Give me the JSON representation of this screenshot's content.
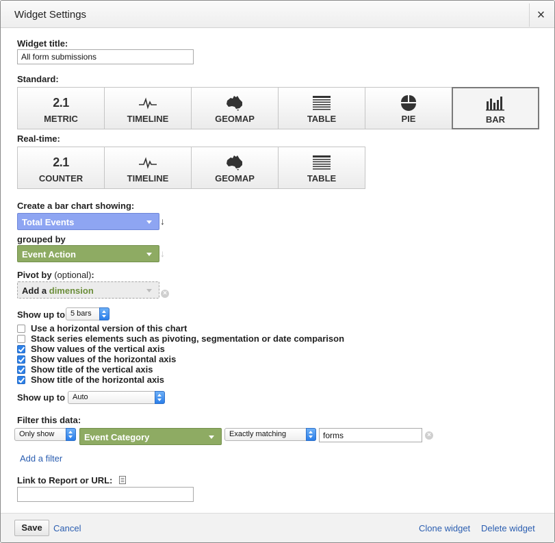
{
  "dialog": {
    "title": "Widget Settings",
    "close_label": "×"
  },
  "widget_title": {
    "label": "Widget title:",
    "value": "All form submissions"
  },
  "standard": {
    "label": "Standard:",
    "tiles": [
      {
        "icon": "metric-icon",
        "icon_text": "2.1",
        "label": "METRIC",
        "selected": false
      },
      {
        "icon": "timeline-icon",
        "label": "TIMELINE",
        "selected": false
      },
      {
        "icon": "geomap-icon",
        "label": "GEOMAP",
        "selected": false
      },
      {
        "icon": "table-icon",
        "label": "TABLE",
        "selected": false
      },
      {
        "icon": "pie-icon",
        "label": "PIE",
        "selected": false
      },
      {
        "icon": "bar-icon",
        "label": "BAR",
        "selected": true
      }
    ]
  },
  "realtime": {
    "label": "Real-time:",
    "tiles": [
      {
        "icon": "counter-icon",
        "icon_text": "2.1",
        "label": "COUNTER"
      },
      {
        "icon": "timeline-icon",
        "label": "TIMELINE"
      },
      {
        "icon": "geomap-icon",
        "label": "GEOMAP"
      },
      {
        "icon": "table-icon",
        "label": "TABLE"
      }
    ]
  },
  "bar_chart": {
    "label": "Create a bar chart showing:",
    "metric": "Total Events",
    "grouped_label": "grouped by",
    "dimension": "Event Action",
    "pivot_label": "Pivot by",
    "pivot_optional": "(optional)",
    "pivot_colon": ":",
    "pivot_add": "Add a",
    "pivot_dimension": "dimension",
    "show_up_to_label": "Show up to",
    "show_up_to_value": "5 bars",
    "options": [
      {
        "label": "Use a horizontal version of this chart",
        "checked": false
      },
      {
        "label": "Stack series elements such as pivoting, segmentation or date comparison",
        "checked": false
      },
      {
        "label": "Show values of the vertical axis",
        "checked": true
      },
      {
        "label": "Show values of the horizontal axis",
        "checked": true
      },
      {
        "label": "Show title of the vertical axis",
        "checked": true
      },
      {
        "label": "Show title of the horizontal axis",
        "checked": true
      }
    ],
    "show_up_to2_label": "Show up to",
    "show_up_to2_value": "Auto"
  },
  "filter": {
    "label": "Filter this data:",
    "mode": "Only show",
    "dimension": "Event Category",
    "match": "Exactly matching",
    "value": "forms",
    "add_filter": "Add a filter"
  },
  "link": {
    "label": "Link to Report or URL:",
    "value": ""
  },
  "footer": {
    "save": "Save",
    "cancel": "Cancel",
    "clone": "Clone widget",
    "delete": "Delete widget"
  },
  "colors": {
    "metric_blue": "#8ea5f2",
    "dimension_green": "#8eab63",
    "link_blue": "#2a5db0",
    "checkbox_blue": "#2e82e8"
  }
}
